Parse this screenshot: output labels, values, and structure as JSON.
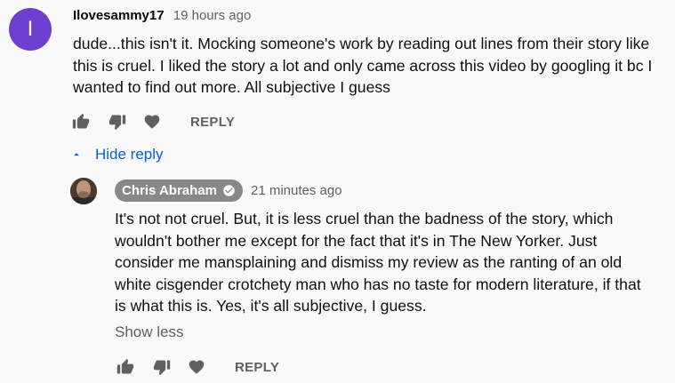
{
  "comment": {
    "avatar_letter": "I",
    "author": "Ilovesammy17",
    "time": "19 hours ago",
    "text": "dude...this isn't it. Mocking someone's work by reading out lines from their story like this is cruel. I liked the story a lot and only came across this video by googling it bc I wanted to find out more. All subjective I guess",
    "reply_label": "REPLY",
    "hide_reply_label": "Hide reply"
  },
  "reply": {
    "author": "Chris Abraham",
    "time": "21 minutes ago",
    "text": "It's not not cruel. But, it is less cruel than the badness of the story, which wouldn't bother me except for the fact that it's in The New Yorker. Just consider me mansplaining and dismiss my review as the ranting of an old white cisgender crotchety man who has no taste for modern literature, if that is what this is. Yes, it's all subjective, I guess.",
    "show_less_label": "Show less",
    "reply_label": "REPLY"
  },
  "icons": [
    "like-icon",
    "dislike-icon",
    "heart-icon",
    "chevron-up-icon",
    "verified-check-icon"
  ],
  "colors": {
    "avatar": "#6d3fd1",
    "link_blue": "#065fd4",
    "author_chip": "#888888",
    "muted": "#606060"
  }
}
